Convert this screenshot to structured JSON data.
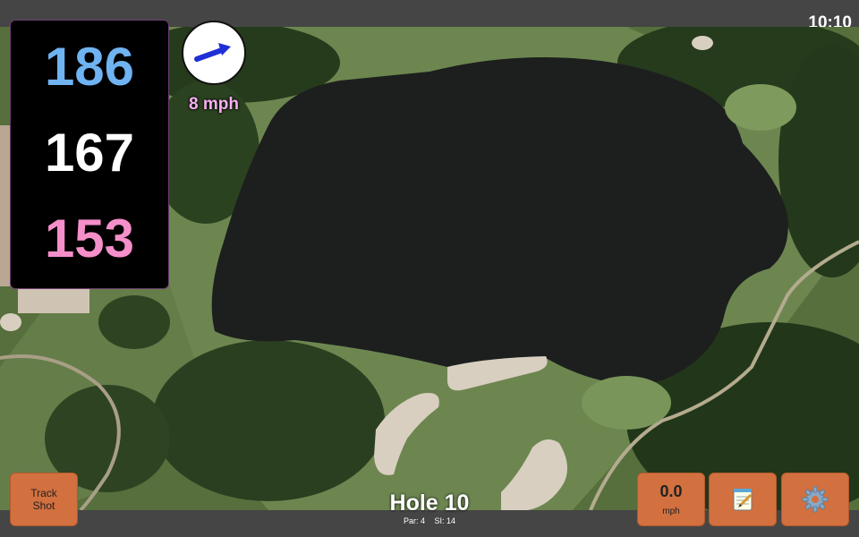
{
  "status_bar": {
    "time": "10:10"
  },
  "distances": {
    "back": "186",
    "middle": "167",
    "front": "153"
  },
  "wind": {
    "speed_label": "8 mph",
    "arrow_icon": "wind-arrow-icon"
  },
  "hole": {
    "title": "Hole 10",
    "par": "Par: 4",
    "stroke_index": "SI: 14"
  },
  "buttons": {
    "track_shot": "Track Shot",
    "speed_value": "0.0",
    "speed_unit": "mph",
    "notes_icon": "notepad-icon",
    "settings_icon": "gear-icon"
  },
  "colors": {
    "back_distance": "#6fb3f2",
    "middle_distance": "#ffffff",
    "front_distance": "#f58fca",
    "button_orange": "#d2703f",
    "wind_text": "#f6b0f0"
  }
}
